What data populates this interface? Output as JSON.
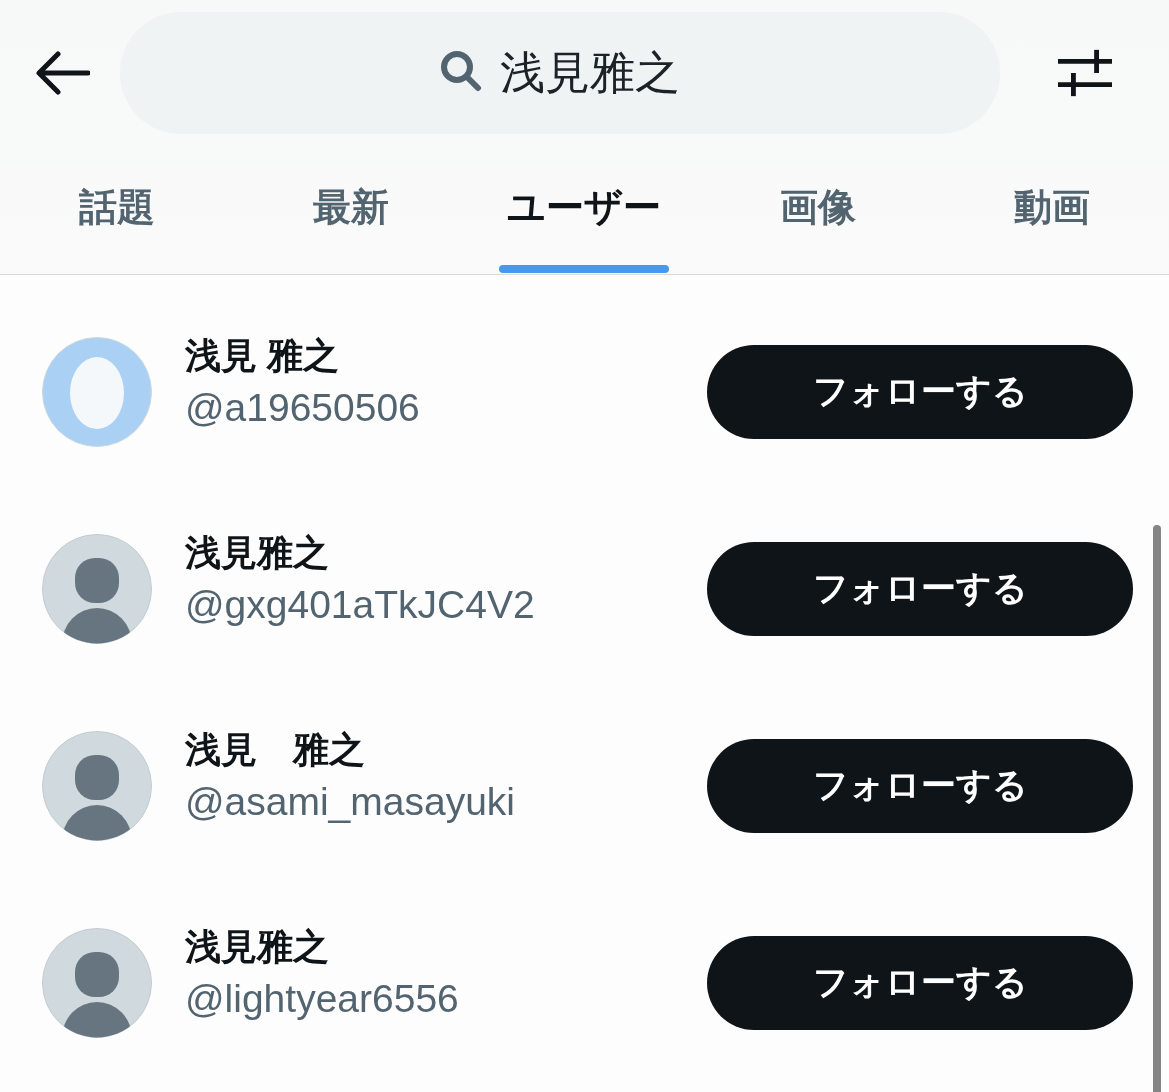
{
  "search": {
    "value": "浅見雅之"
  },
  "tabs": [
    {
      "label": "話題",
      "selected": false
    },
    {
      "label": "最新",
      "selected": false
    },
    {
      "label": "ユーザー",
      "selected": true
    },
    {
      "label": "画像",
      "selected": false
    },
    {
      "label": "動画",
      "selected": false
    }
  ],
  "users": [
    {
      "kind": "egg",
      "name": "浅見 雅之",
      "handle": "@a19650506",
      "button": "フォローする"
    },
    {
      "kind": "silhouette",
      "name": "浅見雅之",
      "handle": "@gxg401aTkJC4V2",
      "button": "フォローする"
    },
    {
      "kind": "silhouette",
      "name": "浅見　雅之",
      "handle": "@asami_masayuki",
      "button": "フォローする"
    },
    {
      "kind": "silhouette",
      "name": "浅見雅之",
      "handle": "@lightyear6556",
      "button": "フォローする"
    }
  ]
}
